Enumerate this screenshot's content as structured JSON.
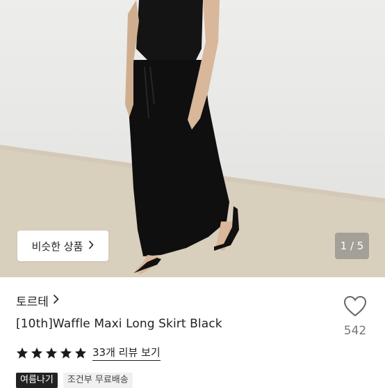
{
  "hero": {
    "similar_label": "비슷한 상품",
    "counter": "1 / 5"
  },
  "product": {
    "brand": "토르테",
    "title": "[10th]Waffle Maxi Long Skirt Black",
    "likes": "542",
    "rating_stars": 5,
    "review_link": "33개 리뷰 보기",
    "tags": [
      "여름나기",
      "조건부 무료배송"
    ]
  },
  "icons": {
    "brand_chevron": "chevron-right-icon",
    "like": "heart-icon",
    "star": "star-icon"
  },
  "colors": {
    "text": "#1a1a1a",
    "muted": "#777777",
    "tag_dark": "#222222",
    "tag_light": "#f0f0f0"
  }
}
